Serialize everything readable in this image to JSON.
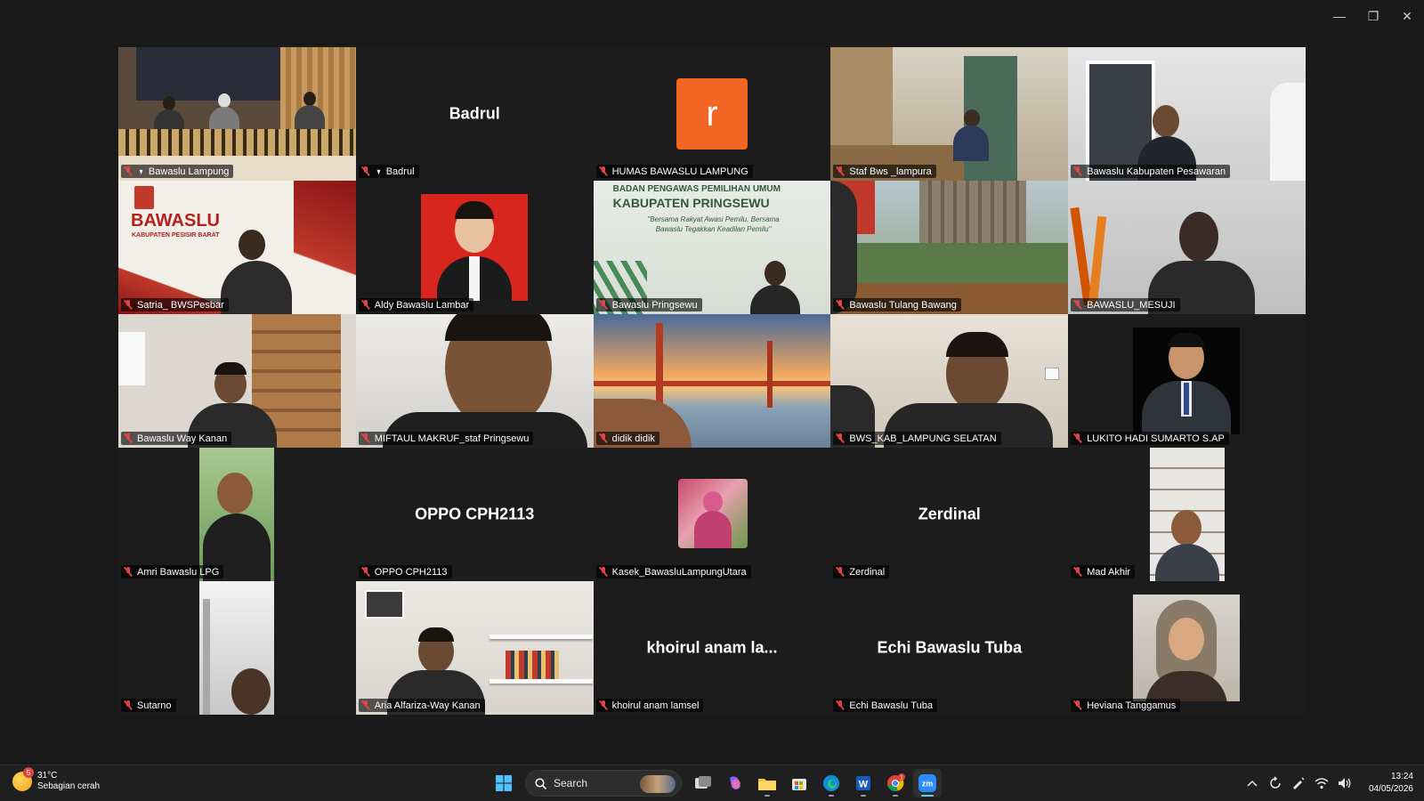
{
  "window": {
    "minimize_glyph": "—",
    "restore_glyph": "❐",
    "close_glyph": "✕"
  },
  "participants": [
    {
      "label": "Bawaslu Lampung",
      "pinned": true,
      "active": true,
      "scene": "room"
    },
    {
      "label": "Badrul",
      "pinned": true,
      "big_name": "Badrul",
      "scene": "name"
    },
    {
      "label": "HUMAS BAWASLU LAMPUNG",
      "avatar_letter": "r",
      "scene": "avatar"
    },
    {
      "label": "Staf Bws _lampura",
      "scene": "office"
    },
    {
      "label": "Bawaslu Kabupaten Pesawaran",
      "scene": "person-light"
    },
    {
      "label": "Satria_ BWSPesbar",
      "scene": "banner",
      "banner_title": "BAWASLU",
      "banner_sub": "KABUPATEN PESISIR BARAT"
    },
    {
      "label": "Aldy Bawaslu Lambar",
      "scene": "redphoto"
    },
    {
      "label": "Bawaslu Pringsewu",
      "scene": "banner2",
      "banner_title": "BADAN PENGAWAS PEMILIHAN UMUM",
      "banner_sub": "KABUPATEN PRINGSEWU",
      "banner_quote": "\"Bersama Rakyat Awasi Pemilu, Bersama Bawaslu Tegakkan Keadilan Pemilu\""
    },
    {
      "label": "Bawaslu Tulang Bawang",
      "scene": "building"
    },
    {
      "label": "BAWASLU_MESUJI",
      "scene": "person-grey"
    },
    {
      "label": "Bawaslu Way Kanan",
      "scene": "door"
    },
    {
      "label": "MIFTAUL MAKRUF_staf Pringsewu",
      "scene": "closeup"
    },
    {
      "label": "didik didik",
      "scene": "bridge"
    },
    {
      "label": "BWS_KAB_LAMPUNG SELATAN",
      "scene": "smile"
    },
    {
      "label": "LUKITO HADI SUMARTO S.AP",
      "scene": "suitphoto"
    },
    {
      "label": "Amri Bawaslu LPG",
      "scene": "portrait-green"
    },
    {
      "label": "OPPO CPH2113",
      "big_name": "OPPO CPH2113",
      "scene": "name"
    },
    {
      "label": "Kasek_BawasluLampungUtara",
      "scene": "smallphoto"
    },
    {
      "label": "Zerdinal",
      "big_name": "Zerdinal",
      "scene": "name"
    },
    {
      "label": "Mad Akhir",
      "scene": "portrait-shelf"
    },
    {
      "label": "Sutarno",
      "scene": "portrait-wall"
    },
    {
      "label": "Aria Alfariza-Way Kanan",
      "scene": "shelfroom"
    },
    {
      "label": "khoirul anam lamsel",
      "big_name": "khoirul anam la...",
      "scene": "name"
    },
    {
      "label": "Echi Bawaslu Tuba",
      "big_name": "Echi Bawaslu Tuba",
      "scene": "name"
    },
    {
      "label": "Heviana Tanggamus",
      "scene": "hijabphoto"
    }
  ],
  "taskbar": {
    "weather_badge": "5",
    "weather_temp": "31°C",
    "weather_desc": "Sebagian cerah",
    "search_label": "Search",
    "time": "13:24",
    "date": "04/05/2026",
    "chrome_badge": "1",
    "zoom_label": "zm",
    "word_label": "W"
  }
}
